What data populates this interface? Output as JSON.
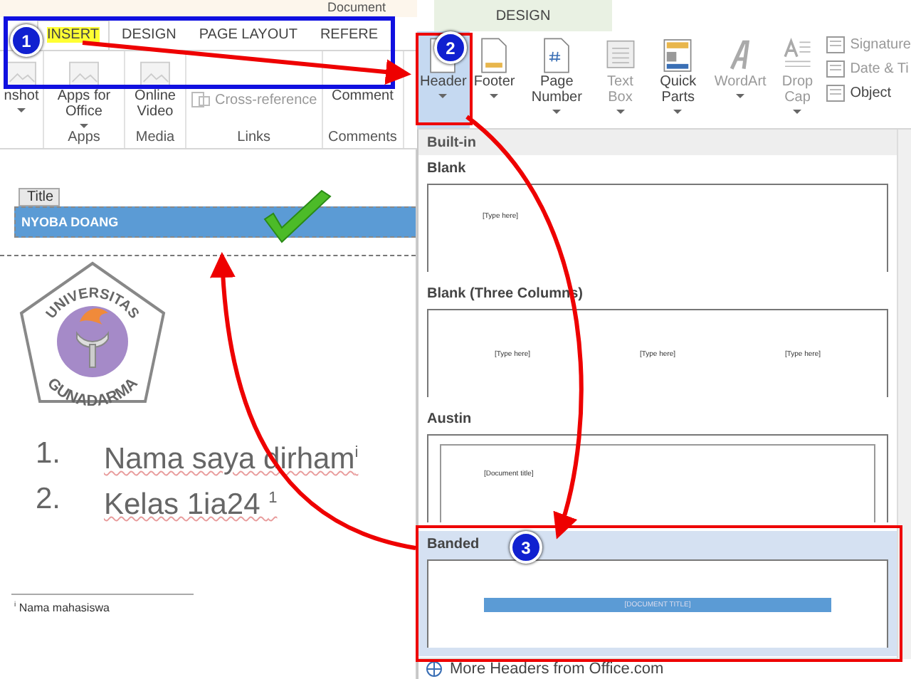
{
  "title_bar": {
    "document": "Document"
  },
  "tabs": [
    {
      "label": "INSERT",
      "selected": true
    },
    {
      "label": "DESIGN",
      "selected": false
    },
    {
      "label": "PAGE LAYOUT",
      "selected": false
    },
    {
      "label": "REFERE",
      "selected": false
    }
  ],
  "insert_ribbon": [
    {
      "items": [
        {
          "label": "nshot",
          "kind": "large",
          "dropdown": true
        }
      ]
    },
    {
      "label": "Apps",
      "items": [
        {
          "label": "Apps for Office",
          "kind": "large",
          "dropdown": true
        }
      ]
    },
    {
      "label": "Media",
      "items": [
        {
          "label": "Online Video",
          "kind": "large",
          "dropdown": false
        }
      ]
    },
    {
      "label": "Links",
      "items": [
        {
          "label": "Cross-reference",
          "kind": "small",
          "dropdown": false
        }
      ]
    },
    {
      "label": "Comments",
      "items": [
        {
          "label": "Comment",
          "kind": "large",
          "dropdown": false
        }
      ]
    }
  ],
  "contextual_tab": {
    "label": "DESIGN"
  },
  "design_ribbon": {
    "large": [
      {
        "label": "Header",
        "selected": true,
        "disabled": false,
        "dropdown": true
      },
      {
        "label": "Footer",
        "selected": false,
        "disabled": false,
        "dropdown": true
      },
      {
        "label": "Page Number",
        "selected": false,
        "disabled": false,
        "dropdown": true
      },
      {
        "label": "Text Box",
        "selected": false,
        "disabled": true,
        "dropdown": true
      },
      {
        "label": "Quick Parts",
        "selected": false,
        "disabled": false,
        "dropdown": true
      },
      {
        "label": "WordArt",
        "selected": false,
        "disabled": true,
        "dropdown": true
      },
      {
        "label": "Drop Cap",
        "selected": false,
        "disabled": true,
        "dropdown": true
      }
    ],
    "small": [
      {
        "label": "Signature",
        "disabled": true
      },
      {
        "label": "Date & Ti",
        "disabled": true
      },
      {
        "label": "Object",
        "disabled": false
      }
    ]
  },
  "gallery": {
    "heading": "Built-in",
    "items": [
      {
        "name": "Blank",
        "kind": "blank",
        "texts": [
          "[Type here]"
        ],
        "selected": false
      },
      {
        "name": "Blank (Three Columns)",
        "kind": "three",
        "texts": [
          "[Type here]",
          "[Type here]",
          "[Type here]"
        ],
        "selected": false
      },
      {
        "name": "Austin",
        "kind": "austin",
        "texts": [
          "[Document title]"
        ],
        "selected": false
      },
      {
        "name": "Banded",
        "kind": "banded",
        "texts": [
          "[DOCUMENT TITLE]"
        ],
        "selected": true
      }
    ],
    "more": "More Headers from Office.com"
  },
  "document": {
    "title_tag": "Title",
    "header_text": "NYOBA DOANG",
    "logo": {
      "top": "UNIVERSITAS",
      "bottom": "GUNADARMA"
    },
    "list": [
      {
        "number": "1.",
        "text": "Nama saya dirham$^{i}$"
      },
      {
        "number": "2.",
        "text": "Kelas 1ia24 $^{1}$"
      }
    ],
    "footnote": "$^{i}$ Nama mahasiswa"
  },
  "annotations": {
    "markers": [
      "1",
      "2",
      "3"
    ]
  }
}
